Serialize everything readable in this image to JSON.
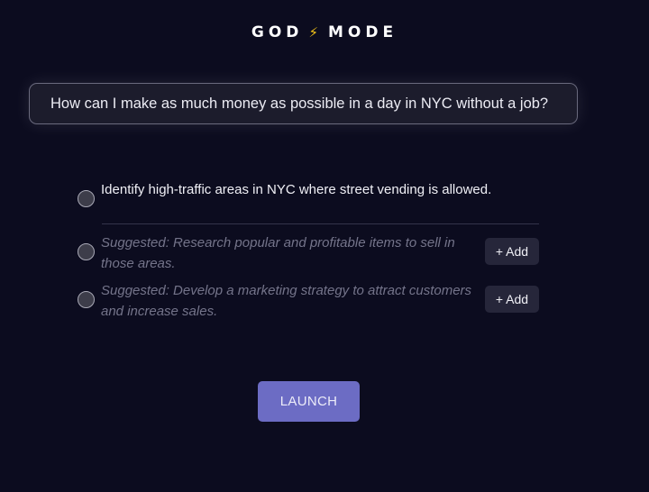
{
  "header": {
    "title_left": "GOD",
    "title_icon": "lightning-bolt-icon",
    "title_icon_glyph": "⚡",
    "title_right": "MODE"
  },
  "prompt": {
    "text": "How can I make as much money as possible in a day in NYC without a job?"
  },
  "tasks": [
    {
      "text": "Identify high-traffic areas in NYC where street vending is allowed."
    }
  ],
  "suggestions": [
    {
      "text": "Suggested: Research popular and profitable items to sell in those areas.",
      "add_label": "+ Add"
    },
    {
      "text": "Suggested: Develop a marketing strategy to attract customers and increase sales.",
      "add_label": "+ Add"
    }
  ],
  "launch": {
    "label": "LAUNCH"
  },
  "colors": {
    "background": "#0c0c1f",
    "accent": "#6c6cc4",
    "bolt": "#f5c518"
  }
}
